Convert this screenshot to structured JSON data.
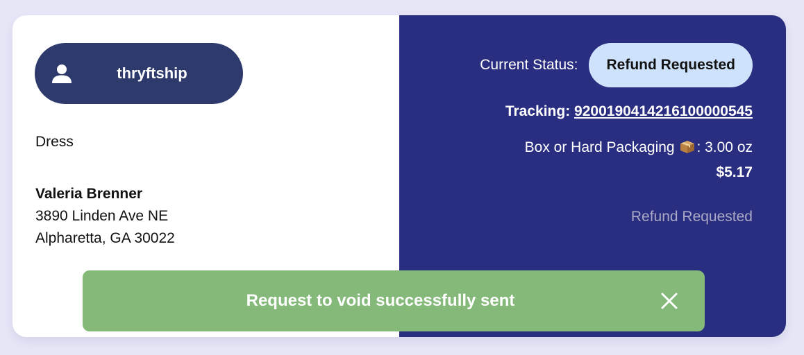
{
  "store": {
    "name": "thryftship",
    "icon": "user-icon"
  },
  "order": {
    "item": "Dress"
  },
  "recipient": {
    "name": "Valeria Brenner",
    "street": "3890 Linden Ave NE",
    "city_line": "Alpharetta, GA 30022"
  },
  "status": {
    "label": "Current Status:",
    "value": "Refund Requested"
  },
  "tracking": {
    "label": "Tracking:",
    "number": "9200190414216100000545"
  },
  "package": {
    "type_label": "Box or Hard Packaging",
    "icon": "package-icon",
    "weight": ": 3.00 oz"
  },
  "price": "$5.17",
  "refund_note": "Refund Requested",
  "toast": {
    "message": "Request to void successfully sent",
    "close_icon": "close-icon"
  },
  "colors": {
    "background": "#e6e6f7",
    "panel_dark": "#2a2e80",
    "store_pill": "#2f3a6c",
    "status_pill": "#cfe2fb",
    "toast": "#84b97a"
  }
}
